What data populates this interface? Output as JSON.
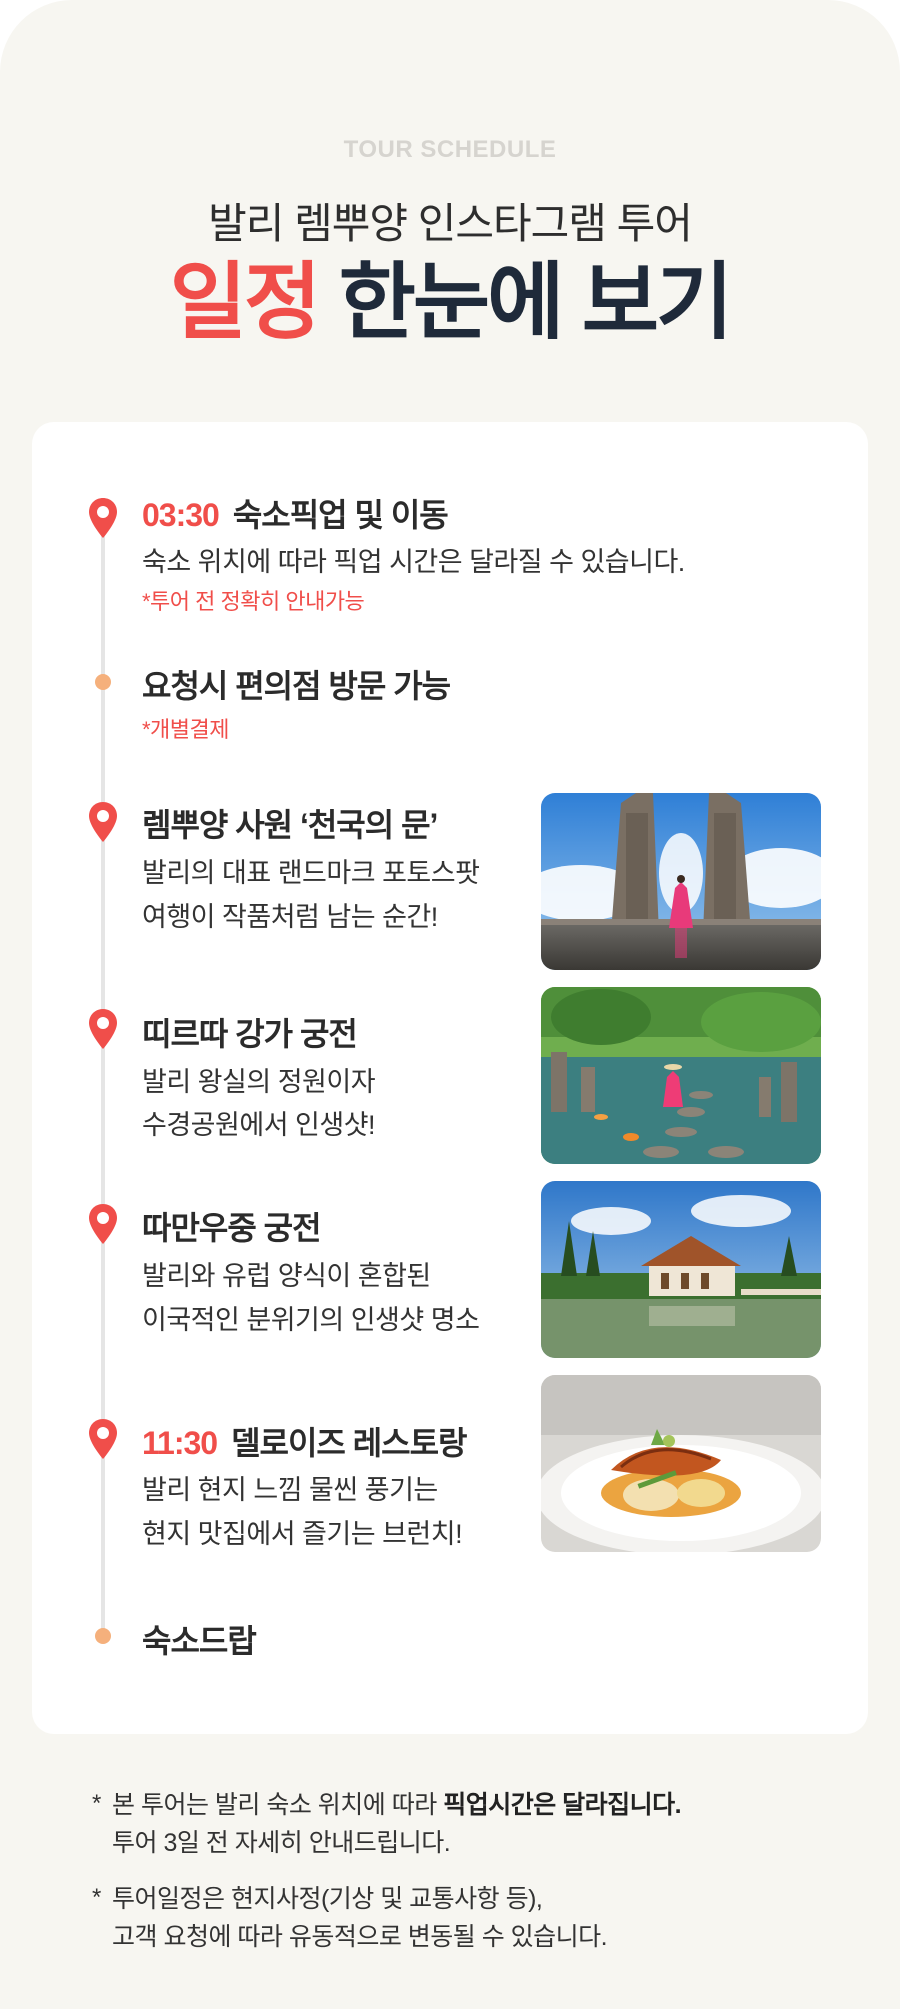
{
  "header": {
    "eyebrow": "TOUR SCHEDULE",
    "subtitle": "발리 렘뿌양 인스타그램 투어",
    "headline_accent": "일정",
    "headline_rest": "한눈에 보기"
  },
  "colors": {
    "accent": "#f04e4a",
    "navy": "#1f2a3a",
    "dot": "#f5b07c",
    "background": "#f7f6f1"
  },
  "schedule": [
    {
      "marker": "pin-icon",
      "time": "03:30",
      "title": "숙소픽업 및 이동",
      "desc1": "숙소 위치에 따라 픽업 시간은 달라질 수 있습니다.",
      "note": "*투어 전 정확히 안내가능"
    },
    {
      "marker": "dot",
      "title": "요청시 편의점 방문 가능",
      "note": "*개별결제"
    },
    {
      "marker": "pin-icon",
      "title": "렘뿌양 사원 ‘천국의 문’",
      "desc1": "발리의 대표 랜드마크 포토스팟",
      "desc2": "여행이 작품처럼 남는 순간!",
      "photo": "temple-gate-photo"
    },
    {
      "marker": "pin-icon",
      "title": "띠르따 강가 궁전",
      "desc1": "발리 왕실의 정원이자",
      "desc2": "수경공원에서 인생샷!",
      "photo": "water-palace-photo"
    },
    {
      "marker": "pin-icon",
      "title": "따만우중 궁전",
      "desc1": "발리와 유럽 양식이 혼합된",
      "desc2": "이국적인 분위기의 인생샷 명소",
      "photo": "taman-ujung-photo"
    },
    {
      "marker": "pin-icon",
      "time": "11:30",
      "title": "델로이즈 레스토랑",
      "desc1": "발리 현지 느낌 물씬 풍기는",
      "desc2": "현지 맛집에서 즐기는 브런치!",
      "photo": "brunch-dish-photo"
    },
    {
      "marker": "dot",
      "title": "숙소드랍"
    }
  ],
  "notes": [
    {
      "star": "*",
      "line1_plain": "본 투어는 발리 숙소 위치에 따라 ",
      "line1_bold": "픽업시간은 달라집니다.",
      "line2": "투어 3일 전 자세히 안내드립니다."
    },
    {
      "star": "*",
      "line1_plain": "투어일정은 현지사정(기상 및 교통사항 등),",
      "line2": "고객 요청에 따라 유동적으로 변동될 수 있습니다."
    }
  ]
}
